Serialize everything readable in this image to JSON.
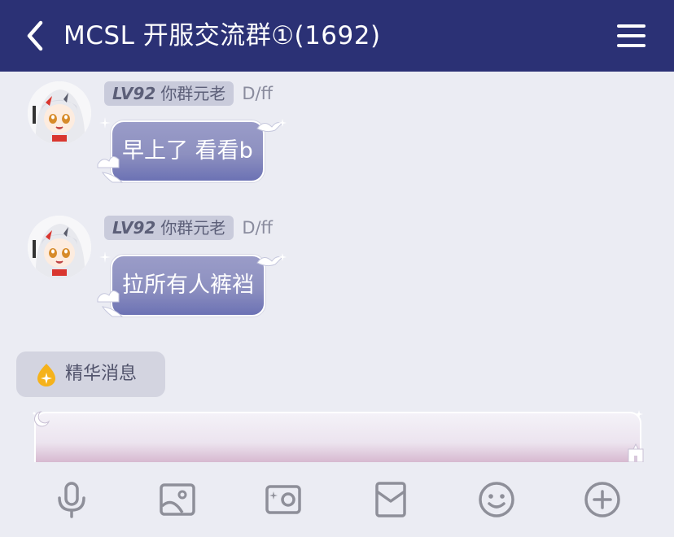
{
  "header": {
    "title": "MCSL 开服交流群①(1692)",
    "back_icon": "chevron-left-icon",
    "menu_icon": "hamburger-menu-icon",
    "background": "#2b3175"
  },
  "messages": [
    {
      "level": "LV92",
      "title_badge": "你群元老",
      "sender": "D/ff",
      "text": "早上了 看看b"
    },
    {
      "level": "LV92",
      "title_badge": "你群元老",
      "sender": "D/ff",
      "text": "拉所有人裤裆"
    }
  ],
  "essence": {
    "label": "精华消息",
    "icon": "flame-sparkle-icon"
  },
  "input": {
    "value": "",
    "placeholder": ""
  },
  "toolbar": {
    "icons": [
      "microphone-icon",
      "image-icon",
      "camera-icon",
      "red-packet-icon",
      "emoji-icon",
      "plus-icon"
    ]
  },
  "colors": {
    "bubble": "#8d90c0",
    "badge": "#c9cbdb",
    "background": "#ebecf3",
    "accent_gold": "#f5b21b"
  }
}
